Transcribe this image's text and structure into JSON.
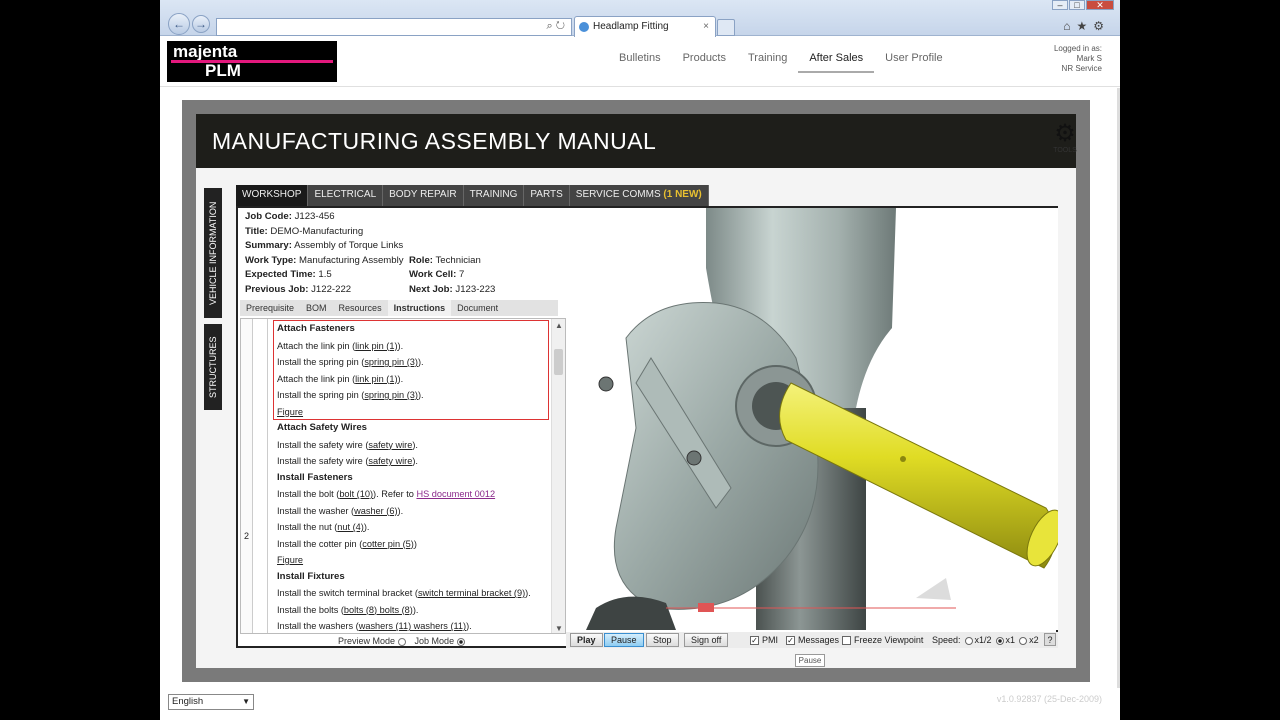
{
  "browser": {
    "tab_title": "Headlamp Fitting",
    "back": "←",
    "forward": "→",
    "tab_close": "×"
  },
  "header": {
    "logo_top": "majenta",
    "logo_bottom": "PLM",
    "nav": [
      "Bulletins",
      "Products",
      "Training",
      "After Sales",
      "User Profile"
    ],
    "active_nav": "After Sales",
    "login": {
      "label": "Logged in as:",
      "user": "Mark S",
      "org": "NR Service"
    }
  },
  "banner": {
    "title": "MANUFACTURING ASSEMBLY MANUAL",
    "tools_label": "TOOLS"
  },
  "side_tabs": [
    "VEHICLE INFORMATION",
    "STRUCTURES"
  ],
  "tabs": [
    {
      "label": "WORKSHOP"
    },
    {
      "label": "ELECTRICAL"
    },
    {
      "label": "BODY REPAIR"
    },
    {
      "label": "TRAINING"
    },
    {
      "label": "PARTS"
    },
    {
      "label": "SERVICE COMMS",
      "badge": "(1 NEW)"
    }
  ],
  "job": {
    "job_code": {
      "label": "Job Code:",
      "value": "J123-456"
    },
    "title": {
      "label": "Title:",
      "value": "DEMO-Manufacturing"
    },
    "summary": {
      "label": "Summary:",
      "value": "Assembly of Torque Links"
    },
    "work_type": {
      "label": "Work Type:",
      "value": "Manufacturing Assembly"
    },
    "role": {
      "label": "Role:",
      "value": "Technician"
    },
    "expected_time": {
      "label": "Expected Time:",
      "value": "1.5"
    },
    "work_cell": {
      "label": "Work Cell:",
      "value": "7"
    },
    "previous_job": {
      "label": "Previous Job:",
      "value": "J122-222"
    },
    "next_job": {
      "label": "Next Job:",
      "value": "J123-223"
    }
  },
  "subtabs": [
    "Prerequisite",
    "BOM",
    "Resources",
    "Instructions",
    "Document"
  ],
  "active_subtab": "Instructions",
  "gutter_number": "2",
  "instructions": [
    {
      "type": "h",
      "text": "Attach Fasteners"
    },
    {
      "type": "i",
      "pre": "Attach the link pin (",
      "u": "link pin (1)",
      "post": ")."
    },
    {
      "type": "i",
      "pre": "Install the spring pin (",
      "u": "spring pin (3)",
      "post": ")."
    },
    {
      "type": "i",
      "pre": "Attach the link pin (",
      "u": "link pin (1)",
      "post": ")."
    },
    {
      "type": "i",
      "pre": "Install the spring pin (",
      "u": "spring pin (3)",
      "post": ")."
    },
    {
      "type": "i",
      "pre": "",
      "u": "Figure",
      "post": ""
    },
    {
      "type": "h",
      "text": "Attach Safety Wires"
    },
    {
      "type": "i",
      "pre": "Install the safety wire (",
      "u": "safety wire",
      "post": ")."
    },
    {
      "type": "i",
      "pre": "Install the safety wire (",
      "u": "safety wire",
      "post": ")."
    },
    {
      "type": "h",
      "text": "Install Fasteners"
    },
    {
      "type": "i",
      "pre": "Install the bolt (",
      "u": "bolt (10)",
      "post": "). Refer to ",
      "link": "HS document 0012"
    },
    {
      "type": "i",
      "pre": "Install the washer (",
      "u": "washer (6)",
      "post": ")."
    },
    {
      "type": "i",
      "pre": "Install the nut (",
      "u": "nut (4)",
      "post": ")."
    },
    {
      "type": "i",
      "pre": "Install the cotter pin (",
      "u": "cotter pin (5)",
      "post": ")"
    },
    {
      "type": "i",
      "pre": "",
      "u": "Figure",
      "post": ""
    },
    {
      "type": "h",
      "text": "Install Fixtures"
    },
    {
      "type": "i",
      "pre": "Install the switch terminal bracket (",
      "u": "switch terminal bracket (9)",
      "post": ")."
    },
    {
      "type": "i",
      "pre": "Install the bolts (",
      "u": "bolts (8) bolts (8)",
      "post": ")."
    },
    {
      "type": "i",
      "pre": "Install the washers (",
      "u": "washers (11) washers (11)",
      "post": ")."
    }
  ],
  "modes": {
    "preview": "Preview Mode",
    "job": "Job Mode",
    "selected": "job"
  },
  "controls": {
    "play": "Play",
    "pause": "Pause",
    "stop": "Stop",
    "signoff": "Sign off",
    "pmi": "PMI",
    "pmi_checked": true,
    "messages": "Messages",
    "messages_checked": true,
    "freeze": "Freeze Viewpoint",
    "freeze_checked": false,
    "speed_label": "Speed:",
    "speeds": [
      "x1/2",
      "x1",
      "x2"
    ],
    "speed_selected": "x1",
    "help": "?"
  },
  "tooltip": "Pause",
  "footer": {
    "language": "English",
    "version": "v1.0.92837 (25-Dec-2009)"
  },
  "colors": {
    "accent": "#e3187d",
    "banner": "#1e1e1a",
    "part_yellow": "#e6e02a",
    "part_gray": "#b7c5c2"
  }
}
